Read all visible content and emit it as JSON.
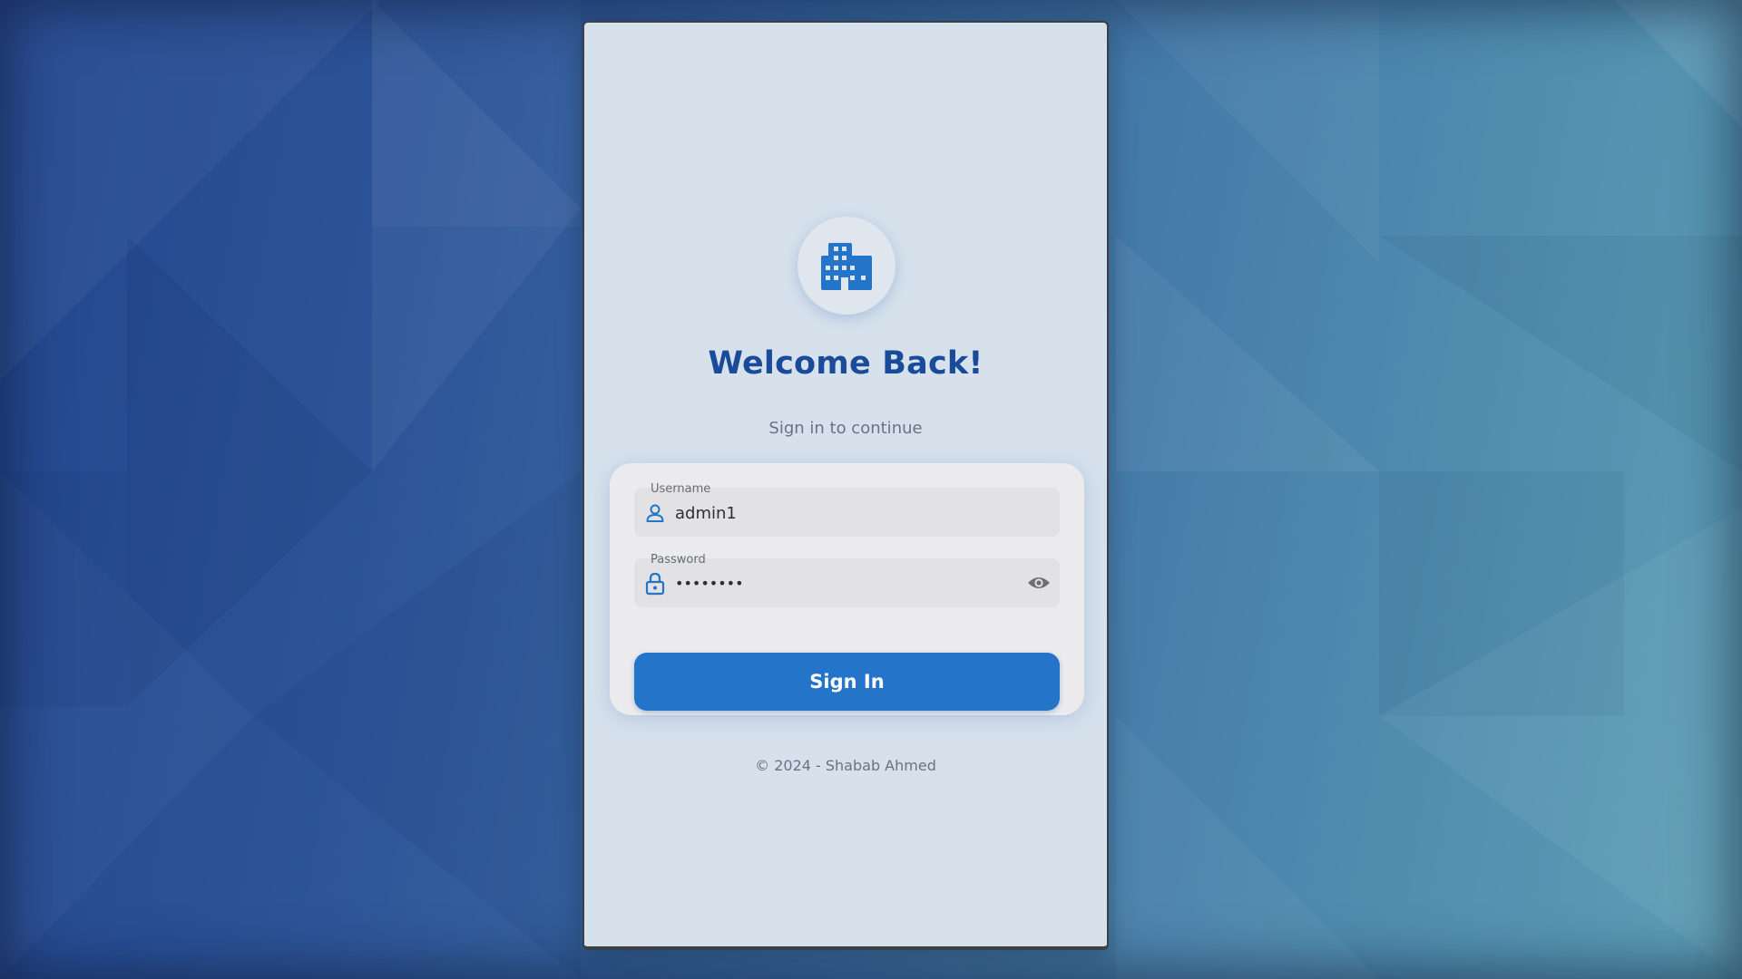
{
  "app": {
    "title": "Welcome Back!",
    "subtitle": "Sign in to continue",
    "footer": "© 2024 - Shabab Ahmed"
  },
  "form": {
    "username": {
      "label": "Username",
      "value": "admin1",
      "icon": "person-icon"
    },
    "password": {
      "label": "Password",
      "masked_value": "••••••••",
      "icon": "lock-icon",
      "toggle_icon": "eye-icon"
    },
    "submit_label": "Sign In"
  },
  "logo": {
    "icon": "building-icon"
  },
  "colors": {
    "primary": "#2474c9",
    "title": "#1a4a9a",
    "card_bg": "#d6e1ec",
    "form_bg": "#ebebed",
    "muted_text": "#6a7380"
  }
}
